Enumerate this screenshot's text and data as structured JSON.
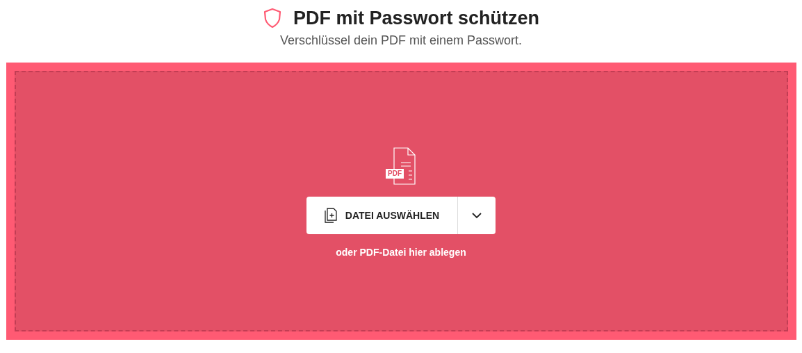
{
  "header": {
    "title": "PDF mit Passwort schützen",
    "subtitle": "Verschlüssel dein PDF mit einem Passwort."
  },
  "dropzone": {
    "file_badge": "PDF",
    "choose_button": "DATEI AUSWÄHLEN",
    "hint": "oder PDF-Datei hier ablegen"
  }
}
